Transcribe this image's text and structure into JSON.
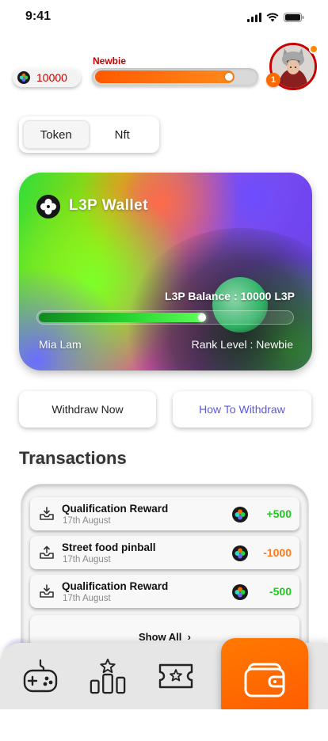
{
  "status_bar": {
    "time": "9:41"
  },
  "user": {
    "coins": "10000",
    "rank": "Newbie",
    "xp_progress": 0.87,
    "level_badge": "1"
  },
  "toggle": {
    "options": [
      "Token",
      "Nft"
    ],
    "selected": "Token"
  },
  "wallet": {
    "title": "L3P  Wallet",
    "balance": "L3P Balance : 10000 L3P",
    "progress": 0.66,
    "name": "Mia Lam",
    "rank_level": "Rank Level : Newbie"
  },
  "actions": {
    "withdraw": "Withdraw Now",
    "how_to": "How To Withdraw"
  },
  "transactions": {
    "title": "Transactions",
    "items": [
      {
        "title": "Qualification Reward",
        "date": "17th August",
        "amount": "+500",
        "direction": "in"
      },
      {
        "title": "Street food pinball",
        "date": "17th August",
        "amount": "-1000",
        "direction": "out"
      },
      {
        "title": "Qualification Reward",
        "date": "17th August",
        "amount": "-500",
        "direction": "in"
      }
    ],
    "show_all": "Show All"
  },
  "nav": {
    "items": [
      "gamepad-icon",
      "leaderboard-icon",
      "ticket-icon",
      "wallet-icon"
    ],
    "active": "wallet-icon"
  },
  "colors": {
    "accent": "#ff6a00",
    "positive": "#1fc81f",
    "negative": "#ff7a1a",
    "rank_red": "#c40000",
    "link": "#5b57e6"
  }
}
